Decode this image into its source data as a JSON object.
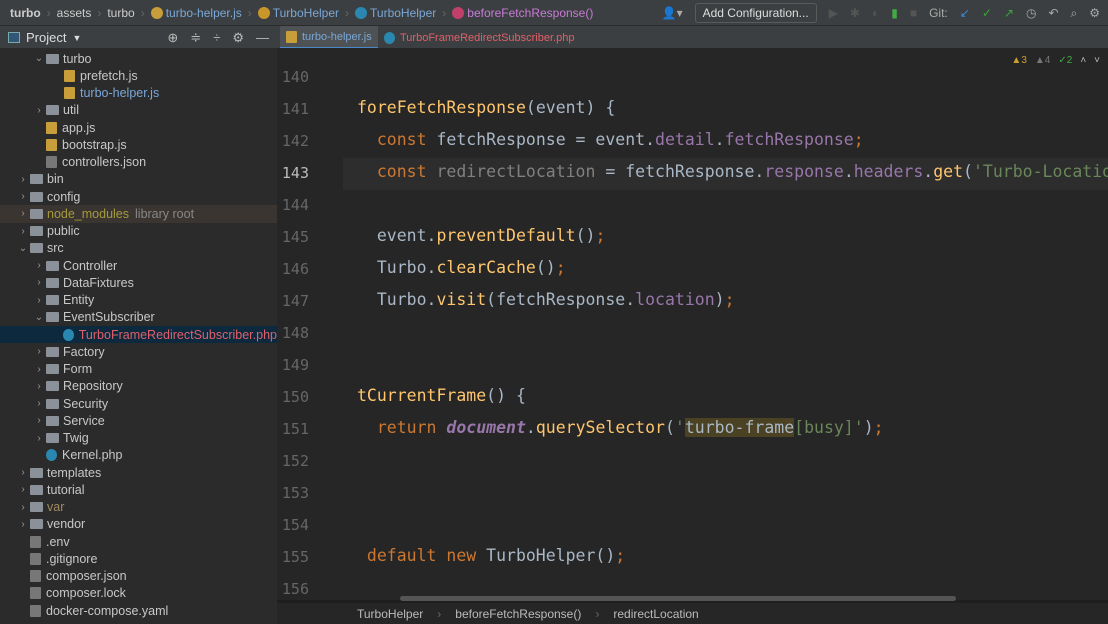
{
  "breadcrumb": [
    "turbo",
    "assets",
    "turbo",
    "turbo-helper.js",
    "TurboHelper",
    "TurboHelper",
    "beforeFetchResponse()"
  ],
  "toolbar": {
    "add_config": "Add Configuration...",
    "git_label": "Git:"
  },
  "project": {
    "title": "Project"
  },
  "tabs": [
    {
      "label": "turbo-helper.js",
      "active": true
    },
    {
      "label": "TurboFrameRedirectSubscriber.php",
      "active": false
    }
  ],
  "inspections": {
    "warnings": "3",
    "weak": "4",
    "ok": "2"
  },
  "tree": [
    {
      "label": "turbo",
      "depth": 2,
      "type": "folder",
      "open": true
    },
    {
      "label": "prefetch.js",
      "depth": 3,
      "type": "js"
    },
    {
      "label": "turbo-helper.js",
      "depth": 3,
      "type": "js",
      "color": "#7aa7d8"
    },
    {
      "label": "util",
      "depth": 2,
      "type": "folder",
      "open": false
    },
    {
      "label": "app.js",
      "depth": 2,
      "type": "js",
      "leaf": true
    },
    {
      "label": "bootstrap.js",
      "depth": 2,
      "type": "js",
      "leaf": true
    },
    {
      "label": "controllers.json",
      "depth": 2,
      "type": "file",
      "leaf": true
    },
    {
      "label": "bin",
      "depth": 1,
      "type": "folder",
      "open": false
    },
    {
      "label": "config",
      "depth": 1,
      "type": "folder",
      "open": false
    },
    {
      "label": "node_modules",
      "depth": 1,
      "type": "folder",
      "open": false,
      "color": "#a59a3a",
      "extra": "library root"
    },
    {
      "label": "public",
      "depth": 1,
      "type": "folder",
      "open": false
    },
    {
      "label": "src",
      "depth": 1,
      "type": "folder",
      "open": true
    },
    {
      "label": "Controller",
      "depth": 2,
      "type": "folder",
      "open": false
    },
    {
      "label": "DataFixtures",
      "depth": 2,
      "type": "folder",
      "open": false
    },
    {
      "label": "Entity",
      "depth": 2,
      "type": "folder",
      "open": false
    },
    {
      "label": "EventSubscriber",
      "depth": 2,
      "type": "folder",
      "open": true
    },
    {
      "label": "TurboFrameRedirectSubscriber.php",
      "depth": 3,
      "type": "php",
      "selected": true,
      "color": "#e0606a"
    },
    {
      "label": "Factory",
      "depth": 2,
      "type": "folder",
      "open": false
    },
    {
      "label": "Form",
      "depth": 2,
      "type": "folder",
      "open": false
    },
    {
      "label": "Repository",
      "depth": 2,
      "type": "folder",
      "open": false
    },
    {
      "label": "Security",
      "depth": 2,
      "type": "folder",
      "open": false
    },
    {
      "label": "Service",
      "depth": 2,
      "type": "folder",
      "open": false
    },
    {
      "label": "Twig",
      "depth": 2,
      "type": "folder",
      "open": false
    },
    {
      "label": "Kernel.php",
      "depth": 2,
      "type": "php",
      "leaf": true
    },
    {
      "label": "templates",
      "depth": 1,
      "type": "folder",
      "open": false
    },
    {
      "label": "tutorial",
      "depth": 1,
      "type": "folder",
      "open": false
    },
    {
      "label": "var",
      "depth": 1,
      "type": "folder",
      "open": false,
      "color": "#a08a60"
    },
    {
      "label": "vendor",
      "depth": 1,
      "type": "folder",
      "open": false
    },
    {
      "label": ".env",
      "depth": 1,
      "type": "file",
      "leaf": true
    },
    {
      "label": ".gitignore",
      "depth": 1,
      "type": "file",
      "leaf": true
    },
    {
      "label": "composer.json",
      "depth": 1,
      "type": "file",
      "leaf": true
    },
    {
      "label": "composer.lock",
      "depth": 1,
      "type": "file",
      "leaf": true
    },
    {
      "label": "docker-compose.yaml",
      "depth": 1,
      "type": "file",
      "leaf": true
    }
  ],
  "lines": [
    {
      "n": "140",
      "tokens": []
    },
    {
      "n": "141",
      "tokens": [
        [
          "f",
          "foreFetchResponse"
        ],
        [
          "",
          "(event) {"
        ]
      ]
    },
    {
      "n": "142",
      "tokens": [
        [
          "",
          "  "
        ],
        [
          "k",
          "const "
        ],
        [
          "",
          "fetchResponse = event."
        ],
        [
          "p",
          "detail"
        ],
        [
          "",
          "."
        ],
        [
          "p",
          "fetchResponse"
        ],
        [
          "k",
          ";"
        ]
      ]
    },
    {
      "n": "143",
      "tokens": [
        [
          "",
          "  "
        ],
        [
          "k",
          "const "
        ],
        [
          "g",
          "redirectLocation"
        ],
        [
          "",
          " = fetchResponse."
        ],
        [
          "p",
          "response"
        ],
        [
          "",
          "."
        ],
        [
          "p",
          "headers"
        ],
        [
          "",
          "."
        ],
        [
          "f",
          "get"
        ],
        [
          "",
          "("
        ],
        [
          "s",
          "'Turbo-Location'"
        ],
        [
          "",
          ")"
        ]
      ]
    },
    {
      "n": "144",
      "tokens": []
    },
    {
      "n": "145",
      "tokens": [
        [
          "",
          "  event."
        ],
        [
          "f",
          "preventDefault"
        ],
        [
          "",
          "()"
        ],
        [
          "k",
          ";"
        ]
      ]
    },
    {
      "n": "146",
      "tokens": [
        [
          "",
          "  Turbo."
        ],
        [
          "f",
          "clearCache"
        ],
        [
          "",
          "()"
        ],
        [
          "k",
          ";"
        ]
      ]
    },
    {
      "n": "147",
      "tokens": [
        [
          "",
          "  Turbo."
        ],
        [
          "f",
          "visit"
        ],
        [
          "",
          "(fetchResponse."
        ],
        [
          "p",
          "location"
        ],
        [
          "",
          ")"
        ],
        [
          "k",
          ";"
        ]
      ]
    },
    {
      "n": "148",
      "tokens": []
    },
    {
      "n": "149",
      "tokens": []
    },
    {
      "n": "150",
      "tokens": [
        [
          "f",
          "tCurrentFrame"
        ],
        [
          "",
          "() {"
        ]
      ]
    },
    {
      "n": "151",
      "tokens": [
        [
          "",
          "  "
        ],
        [
          "k",
          "return "
        ],
        [
          "i",
          "document"
        ],
        [
          "",
          "."
        ],
        [
          "f",
          "querySelector"
        ],
        [
          "",
          "("
        ],
        [
          "s",
          "'"
        ],
        [
          "hl",
          "turbo-frame"
        ],
        [
          "s",
          "[busy]'"
        ],
        [
          "",
          ")"
        ],
        [
          "k",
          ";"
        ]
      ]
    },
    {
      "n": "152",
      "tokens": []
    },
    {
      "n": "153",
      "tokens": []
    },
    {
      "n": "154",
      "tokens": []
    },
    {
      "n": "155",
      "tokens": [
        [
          "",
          ""
        ],
        [
          "k",
          " default new "
        ],
        [
          "",
          "TurboHelper()"
        ],
        [
          "k",
          ";"
        ]
      ]
    },
    {
      "n": "156",
      "tokens": []
    }
  ],
  "status": [
    "TurboHelper",
    "beforeFetchResponse()",
    "redirectLocation"
  ]
}
